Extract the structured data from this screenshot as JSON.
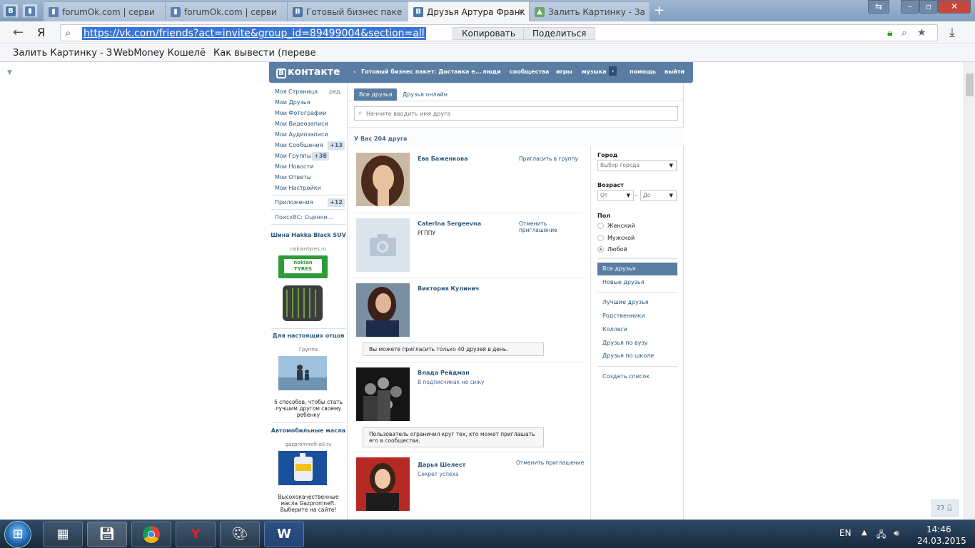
{
  "browser": {
    "tabs": [
      {
        "title": "forumOk.com | серви",
        "icon": "book-icon"
      },
      {
        "title": "forumOk.com | серви",
        "icon": "book-icon"
      },
      {
        "title": "Готовый бизнес паке",
        "icon": "vk-icon"
      },
      {
        "title": "Друзья Артура Франк",
        "icon": "vk-icon",
        "active": true
      },
      {
        "title": "Залить Картинку - За",
        "icon": "picture-icon"
      }
    ],
    "pinned_letter": "В",
    "url": "https://vk.com/friends?act=invite&group_id=89499004&section=all",
    "yandex_glyph": "Я",
    "copy_label": "Копировать",
    "share_label": "Поделиться",
    "bookmarks": [
      "Залить Картинку - З",
      "WebMoney Кошелё",
      "Как вывести (переве"
    ]
  },
  "vk": {
    "logo_letter": "В",
    "logo_text": "контакте",
    "nav": {
      "group": "Готовый бизнес пакет: Доставка е...",
      "people": "люди",
      "communities": "сообщества",
      "games": "игры",
      "music": "музыка",
      "help": "помощь",
      "logout": "выйти"
    },
    "left_menu": {
      "items": [
        {
          "label": "Моя Страница"
        },
        {
          "label": "Мои Друзья"
        },
        {
          "label": "Мои Фотографии"
        },
        {
          "label": "Мои Видеозаписи"
        },
        {
          "label": "Мои Аудиозаписи"
        },
        {
          "label": "Мои Сообщения",
          "badge": "+13"
        },
        {
          "label": "Мои Группы",
          "badge": "+38"
        },
        {
          "label": "Мои Новости"
        },
        {
          "label": "Мои Ответы"
        },
        {
          "label": "Мои Настройки"
        }
      ],
      "edit_label": "ред.",
      "apps_label": "Приложения",
      "apps_badge": "+12",
      "app_item": "ПоискВС: Оценки..."
    },
    "ads": [
      {
        "title": "Шина Hakka Black SUV",
        "sub": "nokiantyres.ru",
        "brand": "nokian TYRES"
      },
      {
        "title": "Для настоящих отцов",
        "sub": "Группа",
        "text": "5 способов, чтобы стать лучшим другом своему ребенку"
      },
      {
        "title": "Автомобильные масла",
        "sub": "gazpromneft-oil.ru",
        "text": "Высококачественные масла Gazpromneft. Выберите на сайте!"
      }
    ],
    "tabs": {
      "all": "Все друзья",
      "online": "Друзья онлайн"
    },
    "search_placeholder": "Начните вводить имя друга",
    "count_text": "У Вас 204 друга",
    "friends": [
      {
        "name": "Ева Баженкова",
        "sub": "",
        "action": "Пригласить в группу"
      },
      {
        "name": "Caterina Sergeevna",
        "sub": "РГППУ",
        "action": "Отменить приглашение"
      },
      {
        "name": "Виктория Кулинич",
        "sub": "",
        "action": "",
        "notice": "Вы можете пригласить только 40 друзей в день."
      },
      {
        "name": "Влада Рейдман",
        "sub": "В подписчиках не сижу",
        "action": "",
        "notice": "Пользователь ограничил круг тех, кто может приглашать его в сообщества."
      },
      {
        "name": "Дарья Шелест",
        "sub": "Секрет успеха",
        "action": "Отменить приглашение"
      }
    ],
    "filters": {
      "city_label": "Город",
      "city_value": "Выбор города",
      "age_label": "Возраст",
      "age_from": "От",
      "age_dash": "-",
      "age_to": "До",
      "sex_label": "Пол",
      "sex_options": [
        "Женский",
        "Мужской",
        "Любой"
      ],
      "sex_selected": "Любой",
      "lists": [
        "Все друзья",
        "Новые друзья"
      ],
      "lists2": [
        "Лучшие друзья",
        "Родственники",
        "Коллеги",
        "Друзья по вузу",
        "Друзья по школе"
      ],
      "create_list": "Создать список"
    },
    "chat_count": "23"
  },
  "taskbar": {
    "lang": "EN",
    "time": "14:46",
    "date": "24.03.2015"
  }
}
